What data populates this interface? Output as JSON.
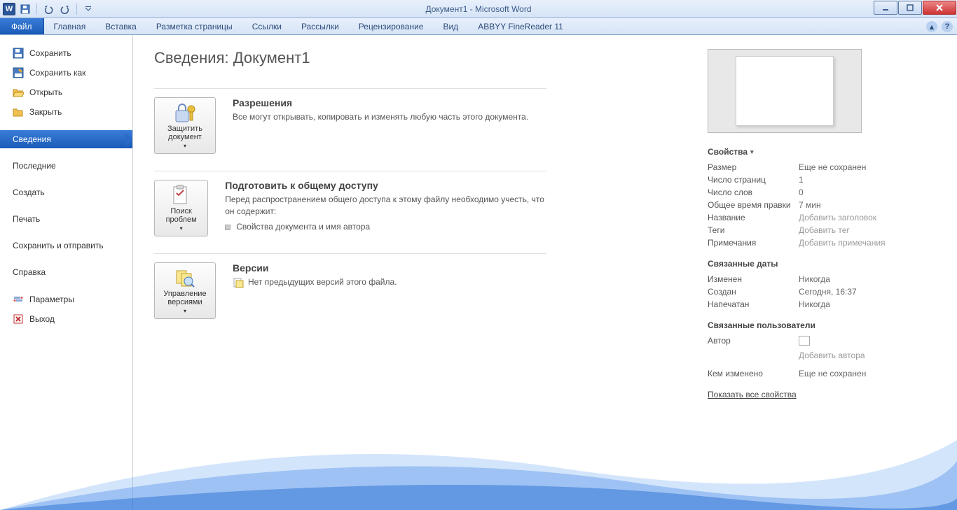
{
  "title": "Документ1 - Microsoft Word",
  "qat": {
    "logo": "W"
  },
  "tabs": {
    "file": "Файл",
    "items": [
      "Главная",
      "Вставка",
      "Разметка страницы",
      "Ссылки",
      "Рассылки",
      "Рецензирование",
      "Вид",
      "ABBYY FineReader 11"
    ]
  },
  "nav": {
    "save": "Сохранить",
    "saveas": "Сохранить как",
    "open": "Открыть",
    "close": "Закрыть",
    "info": "Сведения",
    "recent": "Последние",
    "new": "Создать",
    "print": "Печать",
    "share": "Сохранить и отправить",
    "help": "Справка",
    "options": "Параметры",
    "exit": "Выход"
  },
  "main": {
    "title": "Сведения: Документ1",
    "perm": {
      "btn": "Защитить документ",
      "h": "Разрешения",
      "p": "Все могут открывать, копировать и изменять любую часть этого документа."
    },
    "prep": {
      "btn": "Поиск проблем",
      "h": "Подготовить к общему доступу",
      "p": "Перед распространением общего доступа к этому файлу необходимо учесть, что он содержит:",
      "b1": "Свойства документа и имя автора"
    },
    "ver": {
      "btn": "Управление версиями",
      "h": "Версии",
      "p": "Нет предыдущих версий этого файла."
    }
  },
  "props": {
    "header": "Свойства",
    "size_l": "Размер",
    "size_v": "Еще не сохранен",
    "pages_l": "Число страниц",
    "pages_v": "1",
    "words_l": "Число слов",
    "words_v": "0",
    "time_l": "Общее время правки",
    "time_v": "7 мин",
    "title_l": "Название",
    "title_v": "Добавить заголовок",
    "tags_l": "Теги",
    "tags_v": "Добавить тег",
    "notes_l": "Примечания",
    "notes_v": "Добавить примечания",
    "dates_h": "Связанные даты",
    "mod_l": "Изменен",
    "mod_v": "Никогда",
    "created_l": "Создан",
    "created_v": "Сегодня, 16:37",
    "printed_l": "Напечатан",
    "printed_v": "Никогда",
    "users_h": "Связанные пользователи",
    "author_l": "Автор",
    "author_add": "Добавить автора",
    "modby_l": "Кем изменено",
    "modby_v": "Еще не сохранен",
    "showall": "Показать все свойства"
  }
}
